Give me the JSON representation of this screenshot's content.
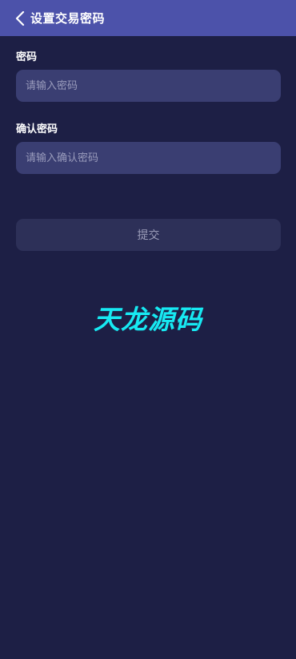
{
  "header": {
    "back_icon": "chevron-left-icon",
    "title": "设置交易密码"
  },
  "form": {
    "password": {
      "label": "密码",
      "placeholder": "请输入密码",
      "value": ""
    },
    "confirm_password": {
      "label": "确认密码",
      "placeholder": "请输入确认密码",
      "value": ""
    },
    "submit_label": "提交"
  },
  "watermark": {
    "text": "天龙源码"
  },
  "colors": {
    "header_bg": "#4c52aa",
    "page_bg": "#1d1f45",
    "input_bg": "#3a3e72",
    "button_bg": "#2d3058",
    "watermark": "#17e9f2"
  }
}
